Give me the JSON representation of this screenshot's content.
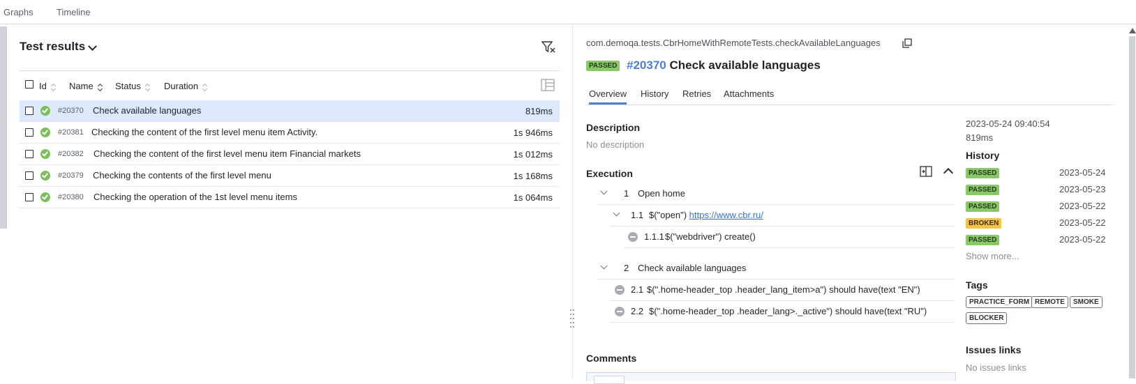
{
  "topbar": {
    "tabs": [
      "Graphs",
      "Timeline"
    ]
  },
  "left": {
    "title": "Test results",
    "columns": [
      "Id",
      "Name",
      "Status",
      "Duration"
    ],
    "rows": [
      {
        "id": "#20370",
        "name": "Check available languages",
        "duration": "819ms"
      },
      {
        "id": "#20381",
        "name": "Checking the content of the first level menu item Activity.",
        "duration": "1s 946ms"
      },
      {
        "id": "#20382",
        "name": "Checking the content of the first level menu item Financial markets",
        "duration": "1s 012ms"
      },
      {
        "id": "#20379",
        "name": "Checking the contents of the first level menu",
        "duration": "1s 168ms"
      },
      {
        "id": "#20380",
        "name": "Checking the operation of the 1st level menu items",
        "duration": "1s 064ms"
      }
    ]
  },
  "right": {
    "full_name": "com.demoqa.tests.CbrHomeWithRemoteTests.checkAvailableLanguages",
    "status": "PASSED",
    "test_id": "#20370",
    "test_name": "Check available languages",
    "tabs": [
      "Overview",
      "History",
      "Retries",
      "Attachments"
    ],
    "description_title": "Description",
    "description_text": "No description",
    "execution_title": "Execution",
    "steps": [
      {
        "num": "1",
        "text": "Open home"
      },
      {
        "num": "1.1",
        "text": "$(\"open\")",
        "link": "https://www.cbr.ru/"
      },
      {
        "num": "1.1.1",
        "text": "$(\"webdriver\") create()"
      },
      {
        "num": "2",
        "text": "Check available languages"
      },
      {
        "num": "2.1",
        "text": "$(\".home-header_top .header_lang_item>a\") should have(text \"EN\")"
      },
      {
        "num": "2.2",
        "text": "$(\".home-header_top .header_lang>._active\") should have(text \"RU\")"
      }
    ],
    "comments_title": "Comments"
  },
  "side": {
    "date": "2023-05-24 09:40:54",
    "duration": "819ms",
    "history_title": "History",
    "history": [
      {
        "status": "PASSED",
        "date": "2023-05-24"
      },
      {
        "status": "PASSED",
        "date": "2023-05-23"
      },
      {
        "status": "PASSED",
        "date": "2023-05-22"
      },
      {
        "status": "BROKEN",
        "date": "2023-05-22"
      },
      {
        "status": "PASSED",
        "date": "2023-05-22"
      }
    ],
    "show_more": "Show more...",
    "tags_title": "Tags",
    "tags": [
      "PRACTICE_FORM",
      "REMOTE",
      "SMOKE",
      "BLOCKER"
    ],
    "issues_title": "Issues links",
    "issues_text": "No issues links"
  },
  "colors": {
    "accent": "#4a7fd4",
    "passed": "#8bc86a",
    "broken": "#f5c446",
    "selected_row": "#dbe9fa"
  }
}
